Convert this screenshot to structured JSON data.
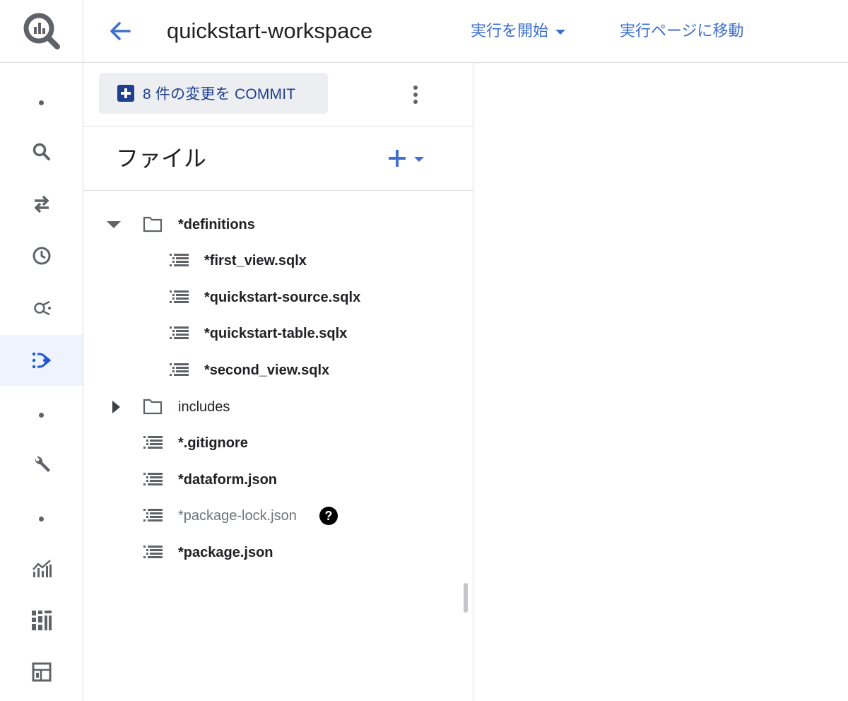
{
  "header": {
    "workspace_title": "quickstart-workspace",
    "run_label": "実行を開始",
    "goto_runs_label": "実行ページに移動"
  },
  "panel": {
    "commit_label": "8 件の変更を COMMIT",
    "files_title": "ファイル"
  },
  "tree": {
    "definitions": "*definitions",
    "first_view": "*first_view.sqlx",
    "qs_source": "*quickstart-source.sqlx",
    "qs_table": "*quickstart-table.sqlx",
    "second_view": "*second_view.sqlx",
    "includes": "includes",
    "gitignore": "*.gitignore",
    "dataform_json": "*dataform.json",
    "package_lock": "*package-lock.json",
    "package_json": "*package.json",
    "help_glyph": "?"
  },
  "colors": {
    "accent": "#3c6fcf",
    "commit_text": "#1f3f8f",
    "active_rail": "#eef3fd"
  },
  "icons": {
    "logo": "bigquery-logo-icon",
    "rail": [
      "dot-icon",
      "search-icon",
      "swap-icon",
      "history-icon",
      "analytics-hub-icon",
      "dataform-icon",
      "dot-icon",
      "wrench-icon",
      "dot-icon",
      "chart-icon",
      "dashboard-icon",
      "table-icon"
    ],
    "file": "file-lines-icon",
    "folder": "folder-outline-icon"
  }
}
